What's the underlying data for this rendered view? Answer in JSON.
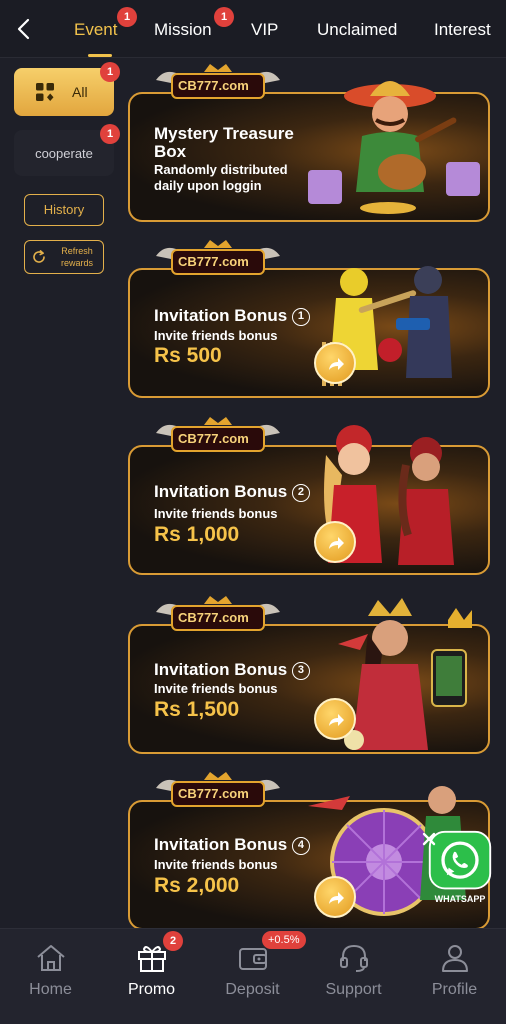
{
  "tabs": [
    {
      "label": "Event",
      "badge": "1",
      "active": true
    },
    {
      "label": "Mission",
      "badge": "1"
    },
    {
      "label": "VIP"
    },
    {
      "label": "Unclaimed"
    },
    {
      "label": "Interest"
    }
  ],
  "categories": [
    {
      "label": "All",
      "badge": "1",
      "active": true
    },
    {
      "label": "cooperate",
      "badge": "1"
    }
  ],
  "history_label": "History",
  "refresh_label": "Refresh rewards",
  "promos": [
    {
      "logo": "CB777.com",
      "title_line1": "Mystery Treasure",
      "title_line2": "Box",
      "subtitle_line1": "Randomly distributed",
      "subtitle_line2": "daily upon loggin"
    },
    {
      "logo": "CB777.com",
      "title": "Invitation Bonus",
      "number": "1",
      "subtitle": "Invite friends bonus",
      "amount": "Rs 500"
    },
    {
      "logo": "CB777.com",
      "title": "Invitation Bonus",
      "number": "2",
      "subtitle": "Invite friends bonus",
      "amount": "Rs 1,000"
    },
    {
      "logo": "CB777.com",
      "title": "Invitation Bonus",
      "number": "3",
      "subtitle": "Invite friends bonus",
      "amount": "Rs 1,500"
    },
    {
      "logo": "CB777.com",
      "title": "Invitation Bonus",
      "number": "4",
      "subtitle": "Invite friends bonus",
      "amount": "Rs 2,000"
    }
  ],
  "whatsapp_label": "WHATSAPP",
  "nav": [
    {
      "label": "Home",
      "icon": "home-icon"
    },
    {
      "label": "Promo",
      "icon": "gift-icon",
      "badge": "2",
      "active": true
    },
    {
      "label": "Deposit",
      "icon": "wallet-icon",
      "badge": "+0.5%"
    },
    {
      "label": "Support",
      "icon": "headset-icon"
    },
    {
      "label": "Profile",
      "icon": "user-icon"
    }
  ],
  "colors": {
    "accent": "#f1c24c",
    "badge": "#e0413c",
    "background": "#1e1f28"
  }
}
